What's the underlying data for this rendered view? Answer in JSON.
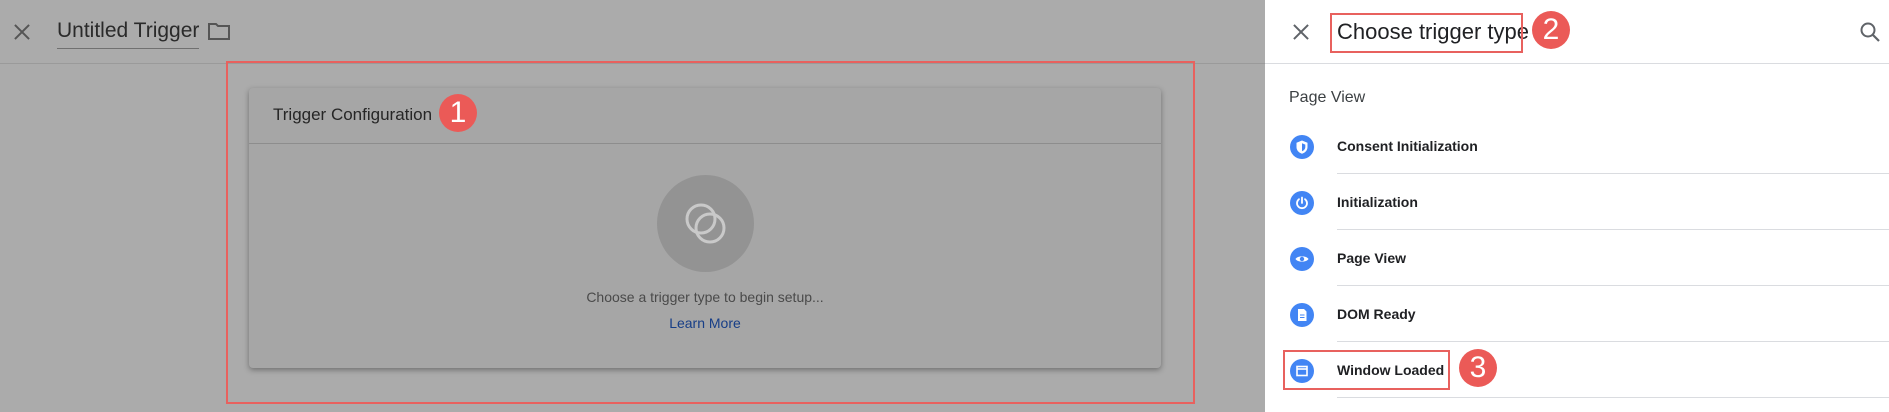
{
  "editor": {
    "trigger_name": "Untitled Trigger",
    "card": {
      "title": "Trigger Configuration",
      "prompt": "Choose a trigger type to begin setup...",
      "learn_more": "Learn More"
    }
  },
  "panel": {
    "title": "Choose trigger type",
    "section": "Page View",
    "items": [
      {
        "label": "Consent Initialization",
        "icon": "shield-icon"
      },
      {
        "label": "Initialization",
        "icon": "power-icon"
      },
      {
        "label": "Page View",
        "icon": "eye-icon"
      },
      {
        "label": "DOM Ready",
        "icon": "document-icon"
      },
      {
        "label": "Window Loaded",
        "icon": "window-icon"
      }
    ]
  },
  "annotations": {
    "badges": [
      "1",
      "2",
      "3"
    ],
    "color": "#e8615e"
  },
  "colors": {
    "accent": "#4285f4",
    "link": "#173e87",
    "overlay": "#ababab"
  }
}
